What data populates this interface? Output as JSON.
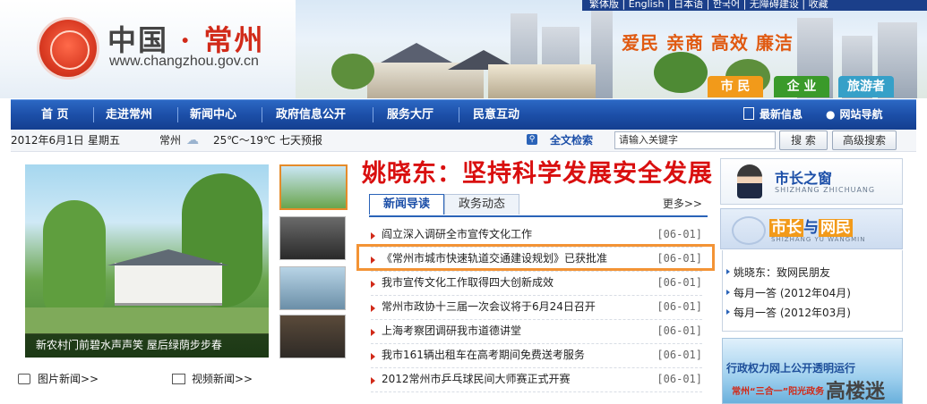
{
  "header": {
    "logo_title_left": "中国",
    "logo_dot": "·",
    "logo_title_right": "常州",
    "logo_url": "www.changzhou.gov.cn",
    "top_links": "繁体版  |  English  |  日本语  |  한국어  |  无障碍建设  |  收藏",
    "slogan": "爱民 亲商 高效 廉洁",
    "role_tabs": [
      {
        "label": "市 民",
        "color": "#f29a1a"
      },
      {
        "label": "企 业",
        "color": "#3a9a2a"
      },
      {
        "label": "旅游者",
        "color": "#36a0c8"
      }
    ]
  },
  "nav": {
    "items": [
      "首 页",
      "走进常州",
      "新闻中心",
      "政府信息公开",
      "服务大厅",
      "民意互动"
    ],
    "right": [
      "最新信息",
      "网站导航"
    ]
  },
  "infobar": {
    "date": "2012年6月1日",
    "weekday": "星期五",
    "city": "常州",
    "temp": "25℃～19℃",
    "forecast": "七天预报",
    "search_label": "全文检索",
    "search_value": "请输入关键字",
    "search_button": "搜 索",
    "advanced_button": "高级搜索"
  },
  "photo": {
    "caption": "新农村门前碧水声声笑 屋后绿荫步步春",
    "links": [
      "图片新闻>>",
      "视频新闻>>"
    ]
  },
  "headline": "姚晓东：坚持科学发展安全发展",
  "news": {
    "tabs": [
      "新闻导读",
      "政务动态"
    ],
    "more": "更多>>",
    "items": [
      {
        "title": "阎立深入调研全市宣传文化工作",
        "date": "[06-01]"
      },
      {
        "title": "《常州市城市快速轨道交通建设规划》已获批准",
        "date": "[06-01]"
      },
      {
        "title": "我市宣传文化工作取得四大创新成效",
        "date": "[06-01]"
      },
      {
        "title": "常州市政协十三届一次会议将于6月24日召开",
        "date": "[06-01]"
      },
      {
        "title": "上海考察团调研我市道德讲堂",
        "date": "[06-01]"
      },
      {
        "title": "我市161辆出租车在高考期间免费送考服务",
        "date": "[06-01]"
      },
      {
        "title": "2012常州市乒乓球民间大师赛正式开赛",
        "date": "[06-01]"
      }
    ]
  },
  "right": {
    "mayor_title": "市长之窗",
    "mayor_pinyin": "SHIZHANG ZHICHUANG",
    "netizen_a": "市长",
    "netizen_mid": "与",
    "netizen_b": "网民",
    "netizen_pinyin": "SHIZHANG YU WANGMIN",
    "list": [
      "姚晓东：致网民朋友",
      "每月一答 (2012年04月)",
      "每月一答 (2012年03月)"
    ],
    "admin_banner": "行政权力网上公开透明运行",
    "admin_banner_sub": "常州“三合一”阳光政务"
  },
  "watermark": "高楼迷"
}
